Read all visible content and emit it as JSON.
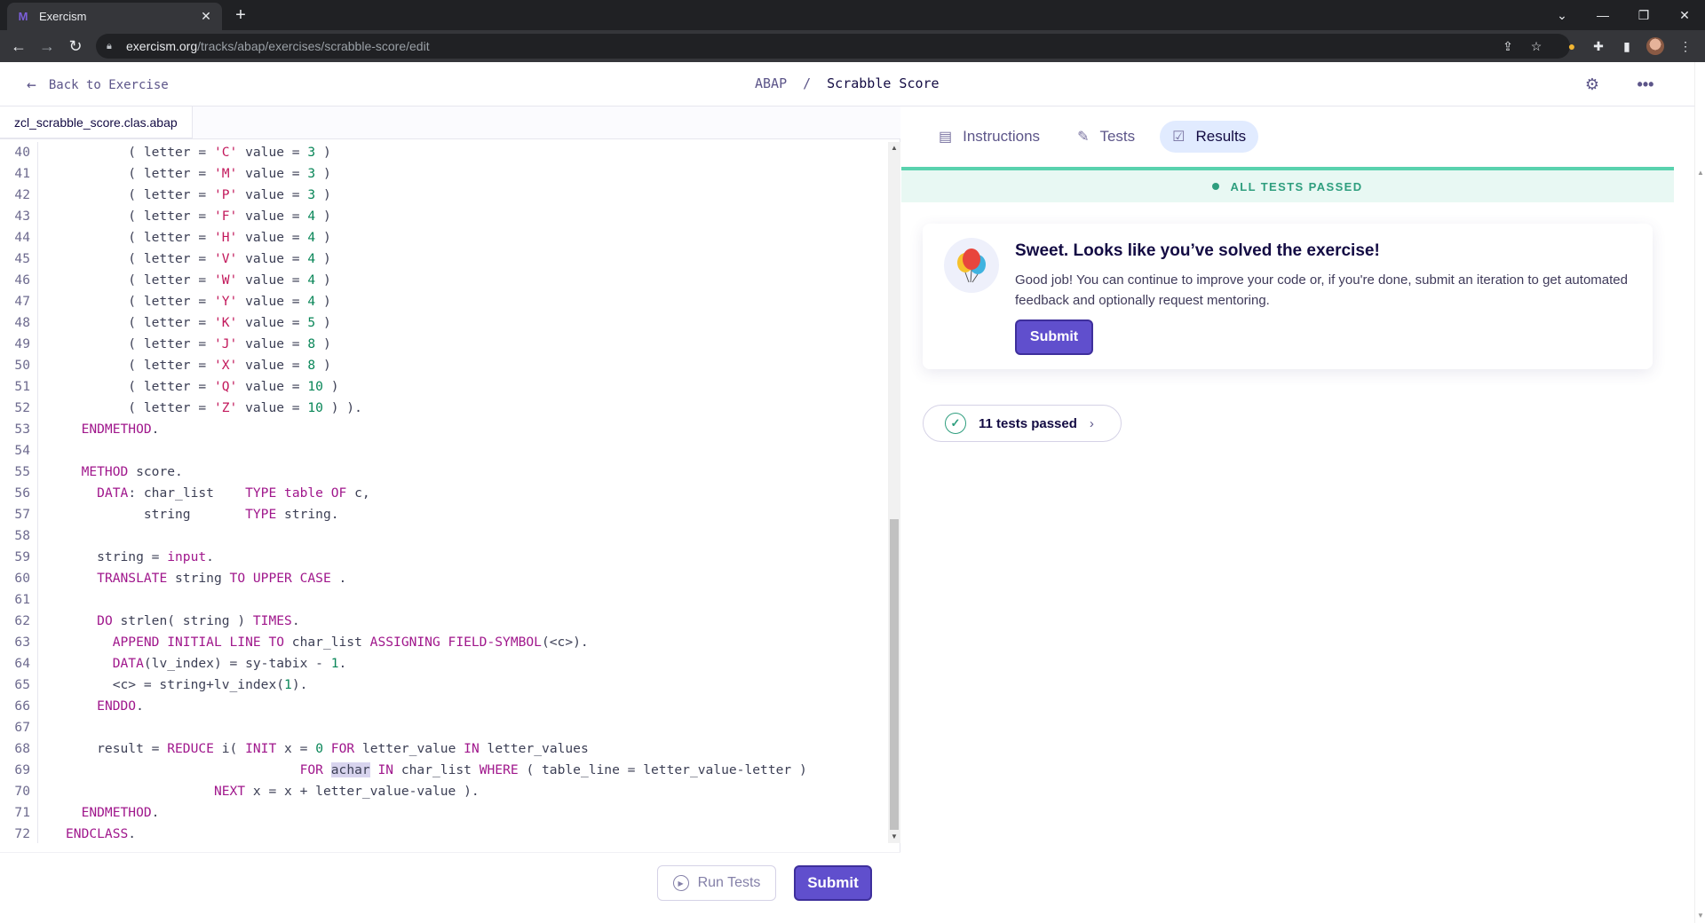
{
  "browser": {
    "tab_title": "Exercism",
    "url_host": "exercism.org",
    "url_path": "/tracks/abap/exercises/scrabble-score/edit"
  },
  "header": {
    "back_label": "Back to Exercise",
    "track": "ABAP",
    "separator": "/",
    "exercise": "Scrabble Score"
  },
  "editor": {
    "filename": "zcl_scrabble_score.clas.abap",
    "lines": [
      {
        "n": "40",
        "html": "        ( letter = <span class=\"st\">'C'</span> value = <span class=\"nm\">3</span> )"
      },
      {
        "n": "41",
        "html": "        ( letter = <span class=\"st\">'M'</span> value = <span class=\"nm\">3</span> )"
      },
      {
        "n": "42",
        "html": "        ( letter = <span class=\"st\">'P'</span> value = <span class=\"nm\">3</span> )"
      },
      {
        "n": "43",
        "html": "        ( letter = <span class=\"st\">'F'</span> value = <span class=\"nm\">4</span> )"
      },
      {
        "n": "44",
        "html": "        ( letter = <span class=\"st\">'H'</span> value = <span class=\"nm\">4</span> )"
      },
      {
        "n": "45",
        "html": "        ( letter = <span class=\"st\">'V'</span> value = <span class=\"nm\">4</span> )"
      },
      {
        "n": "46",
        "html": "        ( letter = <span class=\"st\">'W'</span> value = <span class=\"nm\">4</span> )"
      },
      {
        "n": "47",
        "html": "        ( letter = <span class=\"st\">'Y'</span> value = <span class=\"nm\">4</span> )"
      },
      {
        "n": "48",
        "html": "        ( letter = <span class=\"st\">'K'</span> value = <span class=\"nm\">5</span> )"
      },
      {
        "n": "49",
        "html": "        ( letter = <span class=\"st\">'J'</span> value = <span class=\"nm\">8</span> )"
      },
      {
        "n": "50",
        "html": "        ( letter = <span class=\"st\">'X'</span> value = <span class=\"nm\">8</span> )"
      },
      {
        "n": "51",
        "html": "        ( letter = <span class=\"st\">'Q'</span> value = <span class=\"nm\">10</span> )"
      },
      {
        "n": "52",
        "html": "        ( letter = <span class=\"st\">'Z'</span> value = <span class=\"nm\">10</span> ) )."
      },
      {
        "n": "53",
        "html": "  <span class=\"kw\">ENDMETHOD</span>."
      },
      {
        "n": "54",
        "html": ""
      },
      {
        "n": "55",
        "html": "  <span class=\"kw\">METHOD</span> score."
      },
      {
        "n": "56",
        "html": "    <span class=\"kw\">DATA</span>: char_list    <span class=\"kw\">TYPE table OF</span> c,"
      },
      {
        "n": "57",
        "html": "          string       <span class=\"kw\">TYPE</span> string."
      },
      {
        "n": "58",
        "html": ""
      },
      {
        "n": "59",
        "html": "    string = <span class=\"kw\">input</span>."
      },
      {
        "n": "60",
        "html": "    <span class=\"kw\">TRANSLATE</span> string <span class=\"kw\">TO UPPER CASE</span> ."
      },
      {
        "n": "61",
        "html": ""
      },
      {
        "n": "62",
        "html": "    <span class=\"kw\">DO</span> strlen( string ) <span class=\"kw\">TIMES</span>."
      },
      {
        "n": "63",
        "html": "      <span class=\"kw\">APPEND INITIAL LINE TO</span> char_list <span class=\"kw\">ASSIGNING FIELD-SYMBOL</span>(&lt;c&gt;)."
      },
      {
        "n": "64",
        "html": "      <span class=\"kw\">DATA</span>(lv_index) = sy-tabix - <span class=\"nm\">1</span>."
      },
      {
        "n": "65",
        "html": "      &lt;c&gt; = string+lv_index(<span class=\"nm\">1</span>)."
      },
      {
        "n": "66",
        "html": "    <span class=\"kw\">ENDDO</span>."
      },
      {
        "n": "67",
        "html": ""
      },
      {
        "n": "68",
        "html": "    result = <span class=\"kw\">REDUCE</span> i( <span class=\"kw\">INIT</span> x = <span class=\"nm\">0</span> <span class=\"kw\">FOR</span> letter_value <span class=\"kw\">IN</span> letter_values"
      },
      {
        "n": "69",
        "html": "                              <span class=\"kw\">FOR</span> <span class=\"hl\">achar</span> <span class=\"kw\">IN</span> char_list <span class=\"kw\">WHERE</span> ( table_line = letter_value-letter )"
      },
      {
        "n": "70",
        "html": "                   <span class=\"kw\">NEXT</span> x = x + letter_value-value )."
      },
      {
        "n": "71",
        "html": "  <span class=\"kw\">ENDMETHOD</span>."
      },
      {
        "n": "72",
        "html": "<span class=\"kw\">ENDCLASS</span>."
      }
    ],
    "run_tests_label": "Run Tests",
    "submit_label": "Submit"
  },
  "panel": {
    "tabs": [
      {
        "label": "Instructions",
        "icon": "book-icon"
      },
      {
        "label": "Tests",
        "icon": "tests-icon"
      },
      {
        "label": "Results",
        "icon": "results-icon"
      }
    ],
    "active_tab": "Results",
    "banner": "ALL TESTS PASSED",
    "card_title": "Sweet. Looks like you’ve solved the exercise!",
    "card_body": "Good job! You can continue to improve your code or, if you're done, submit an iteration to get automated feedback and optionally request mentoring.",
    "card_submit": "Submit",
    "tests_passed": "11 tests passed"
  },
  "colors": {
    "accent": "#604fcd",
    "success": "#2e9e7e",
    "banner_bg": "#e8f8f3"
  }
}
